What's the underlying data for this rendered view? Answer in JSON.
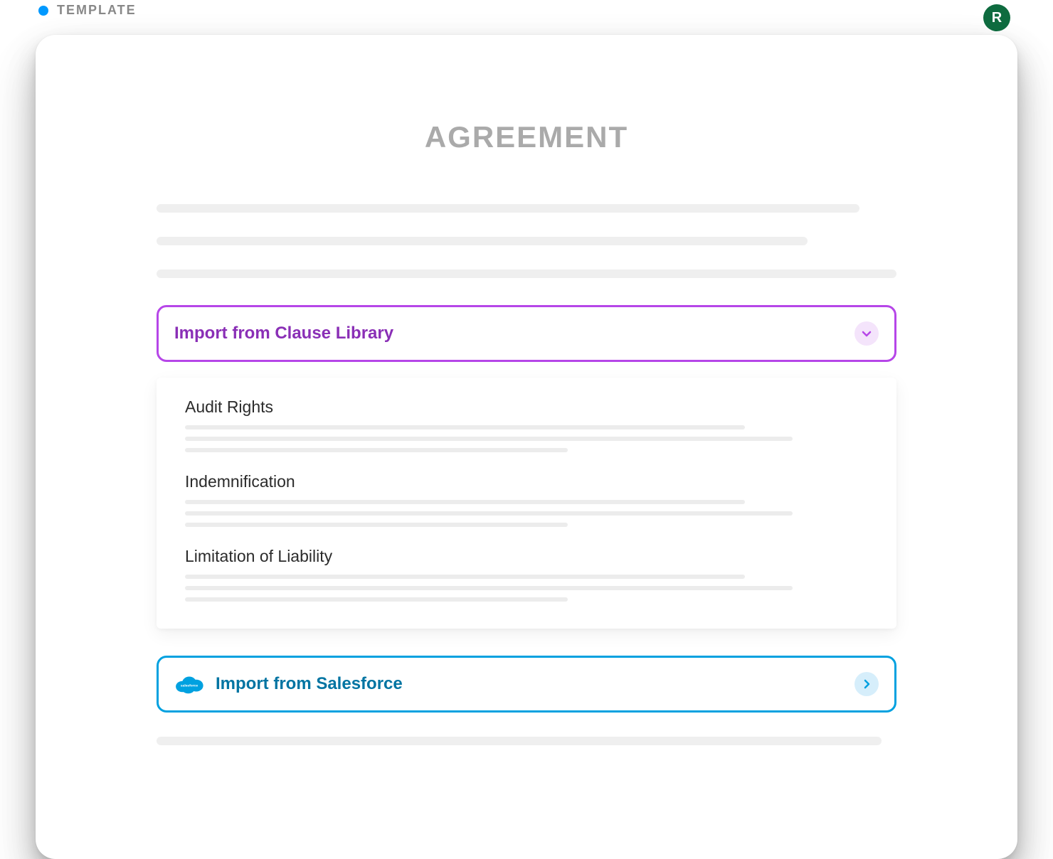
{
  "header": {
    "tag": "TEMPLATE",
    "avatar_initial": "R"
  },
  "document": {
    "title": "AGREEMENT"
  },
  "clause_dropdown": {
    "label": "Import from Clause Library",
    "options": [
      {
        "title": "Audit Rights"
      },
      {
        "title": "Indemnification"
      },
      {
        "title": "Limitation of Liability"
      }
    ]
  },
  "salesforce_dropdown": {
    "label": "Import from Salesforce",
    "icon_text": "salesforce"
  }
}
